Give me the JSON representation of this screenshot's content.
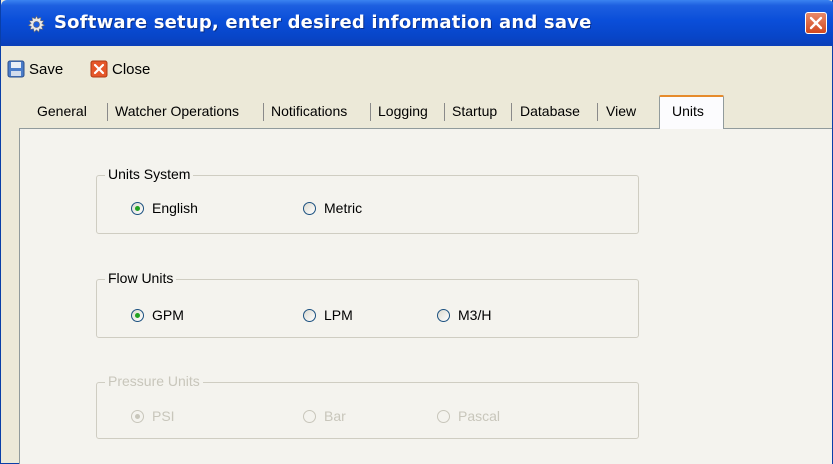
{
  "window": {
    "title": "Software setup, enter desired information and save"
  },
  "toolbar": {
    "save_label": "Save",
    "close_label": "Close"
  },
  "tabs": [
    {
      "label": "General",
      "active": false
    },
    {
      "label": "Watcher Operations",
      "active": false
    },
    {
      "label": "Notifications",
      "active": false
    },
    {
      "label": "Logging",
      "active": false
    },
    {
      "label": "Startup",
      "active": false
    },
    {
      "label": "Database",
      "active": false
    },
    {
      "label": "View",
      "active": false
    },
    {
      "label": "Units",
      "active": true
    }
  ],
  "units_system": {
    "label": "Units System",
    "options": [
      {
        "label": "English",
        "selected": true
      },
      {
        "label": "Metric",
        "selected": false
      }
    ]
  },
  "flow_units": {
    "label": "Flow Units",
    "options": [
      {
        "label": "GPM",
        "selected": true
      },
      {
        "label": "LPM",
        "selected": false
      },
      {
        "label": "M3/H",
        "selected": false
      }
    ]
  },
  "pressure_units": {
    "label": "Pressure Units",
    "enabled": false,
    "options": [
      {
        "label": "PSI",
        "selected": true
      },
      {
        "label": "Bar",
        "selected": false
      },
      {
        "label": "Pascal",
        "selected": false
      }
    ]
  },
  "colors": {
    "titlebar": "#0a4ed9",
    "close_button": "#d2481f",
    "active_tab_accent": "#e68b2c",
    "radio_dot": "#21a121",
    "disabled_text": "#c8c6bb"
  },
  "icons": {
    "title": "gear-icon",
    "window_close": "close-icon",
    "save": "floppy-disk-icon",
    "close": "close-icon"
  }
}
